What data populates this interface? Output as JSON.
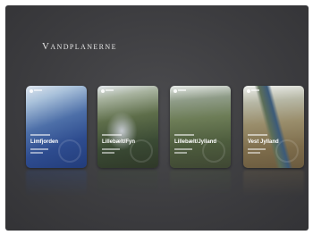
{
  "app": {
    "title": "Vandplanerne"
  },
  "cards": [
    {
      "name": "Limfjorden"
    },
    {
      "name": "Lillebælt/Fyn"
    },
    {
      "name": "Lillebælt/Jylland"
    },
    {
      "name": "Vest Jylland"
    }
  ],
  "colors": {
    "background": "#3c3c3f",
    "title": "#e6e6e6",
    "card_text": "#ffffff"
  }
}
